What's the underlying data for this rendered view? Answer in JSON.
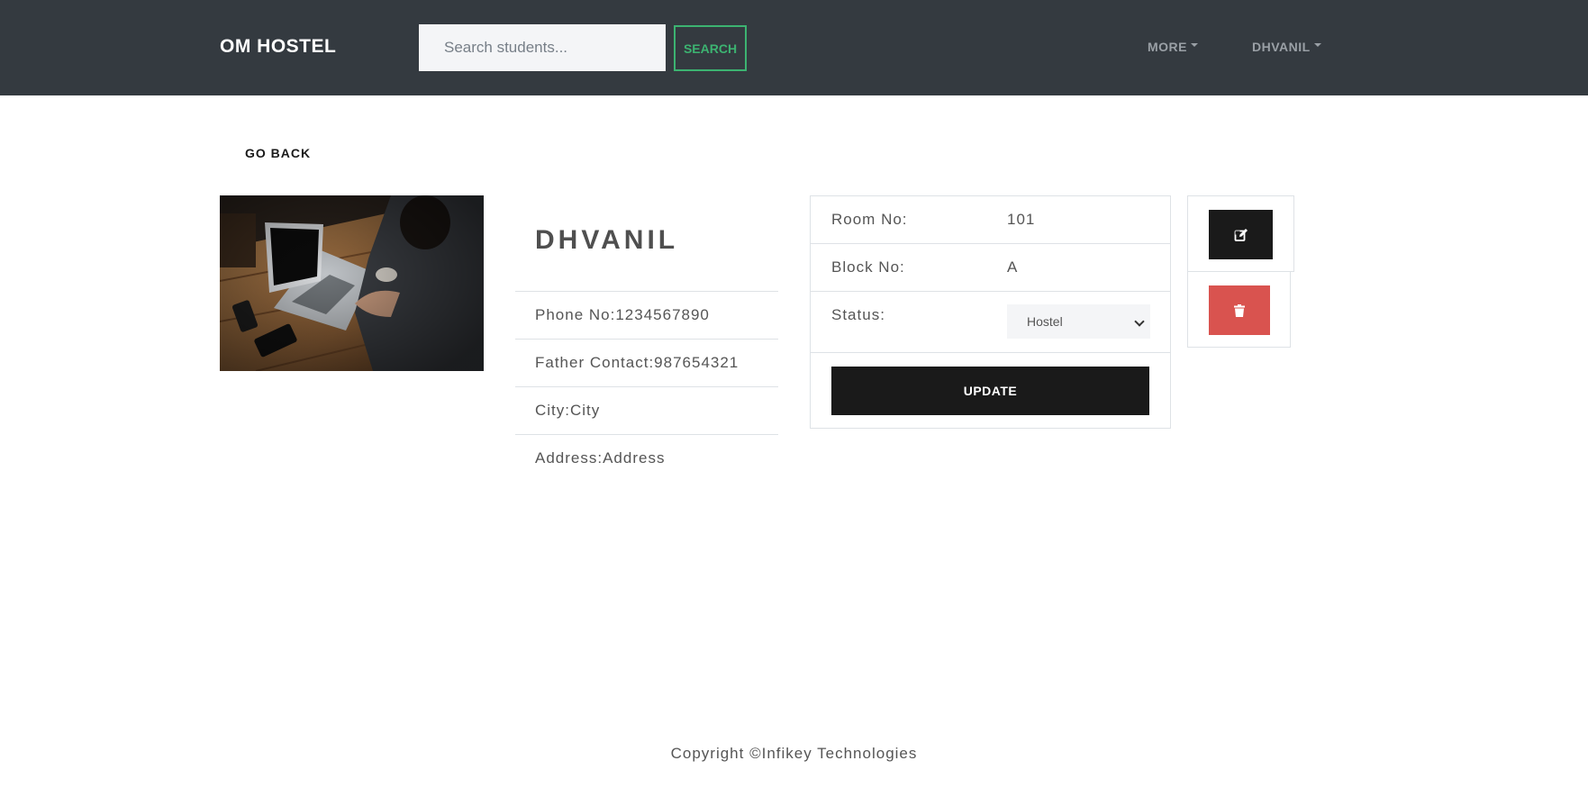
{
  "navbar": {
    "brand": "OM HOSTEL",
    "search": {
      "placeholder": "Search students...",
      "value": ""
    },
    "search_button": "SEARCH",
    "menus": [
      {
        "label": "MORE"
      },
      {
        "label": "DHVANIL"
      }
    ]
  },
  "page": {
    "go_back_label": "GO BACK"
  },
  "student": {
    "photo_description": "laptop-photo",
    "name": "DHVANIL",
    "info": [
      {
        "label": "Phone No:",
        "value": "1234567890"
      },
      {
        "label": "Father Contact:",
        "value": "987654321"
      },
      {
        "label": "City:",
        "value": "City"
      },
      {
        "label": "Address:",
        "value": "Address"
      }
    ]
  },
  "details": {
    "room": {
      "label": "Room No:",
      "value": "101"
    },
    "block": {
      "label": "Block No:",
      "value": "A"
    },
    "status": {
      "label": "Status:",
      "selected": "Hostel"
    },
    "update_button": "UPDATE"
  },
  "actions": {
    "edit_icon": "edit-icon",
    "delete_icon": "trash-icon"
  },
  "footer": {
    "copyright": "Copyright ©Infikey Technologies"
  },
  "colors": {
    "navbar_bg": "#343a40",
    "search_accent": "#3cb371",
    "dark_button": "#1a1a1a",
    "delete_button": "#d9534f"
  }
}
